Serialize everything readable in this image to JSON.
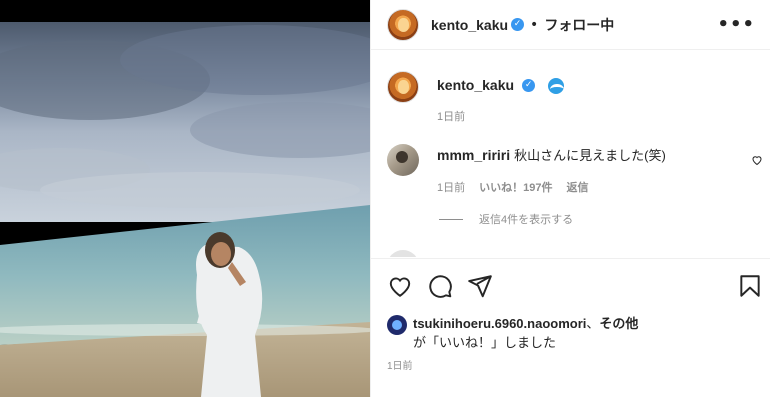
{
  "header": {
    "username": "kento_kaku",
    "separator": "•",
    "follow_label": "フォロー中",
    "more_label": "•••"
  },
  "caption": {
    "username": "kento_kaku",
    "time": "1日前"
  },
  "comment": {
    "username": "mmm_ririri",
    "text": "秋山さんに見えました(笑)",
    "time": "1日前",
    "likes": "いいね！197件",
    "reply_label": "返信"
  },
  "replies": {
    "label": "返信4件を表示する"
  },
  "likes": {
    "username": "tsukinihoeru.6960.naoomori",
    "separator": "、",
    "others": "その他",
    "suffix": "が「いいね！」しました"
  },
  "post_time": "1日前",
  "icons": {
    "verified": "verified-badge-icon",
    "like": "heart-icon",
    "comment": "comment-icon",
    "share": "share-icon",
    "save": "bookmark-icon",
    "more": "more-options-icon",
    "wave": "wave-emoji-icon"
  },
  "colors": {
    "verified": "#3897f0",
    "muted_text": "#8e8e8e",
    "text": "#262626"
  }
}
